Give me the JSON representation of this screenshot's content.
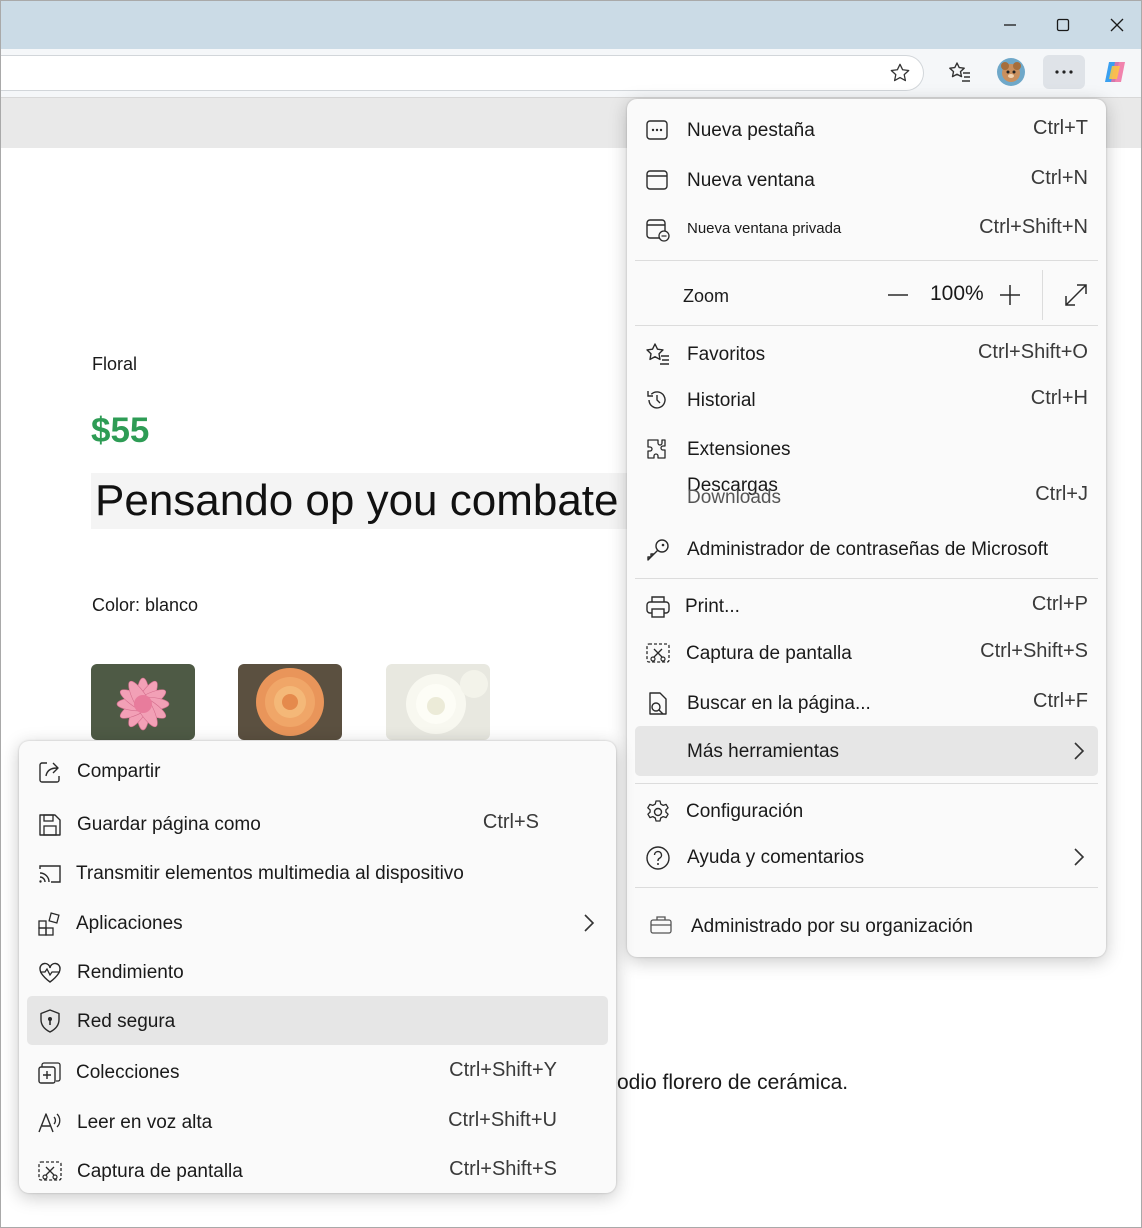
{
  "window": {
    "controls": {
      "minimize": "minimize-icon",
      "maximize": "maximize-icon",
      "close": "close-icon"
    }
  },
  "toolbar": {
    "icons": [
      "star-icon",
      "favorites-icon",
      "profile-avatar",
      "more-icon",
      "copilot-icon"
    ]
  },
  "page": {
    "category": "Floral",
    "price": "$55",
    "headline": "Pensando op you combate u",
    "color_label": "Color: blanco",
    "body_fragment": "odio florero de cerámica.",
    "swatches": [
      "pink-flower",
      "orange-flower",
      "white-flower"
    ]
  },
  "main_menu": {
    "new_tab": {
      "label": "Nueva pestaña",
      "shortcut": "Ctrl+T"
    },
    "new_window": {
      "label": "Nueva ventana",
      "shortcut": "Ctrl+N"
    },
    "private_window": {
      "label": "Nueva ventana privada",
      "shortcut": "Ctrl+Shift+N"
    },
    "zoom": {
      "label": "Zoom",
      "value": "100%"
    },
    "favorites": {
      "label": "Favoritos",
      "shortcut": "Ctrl+Shift+O"
    },
    "history": {
      "label": "Historial",
      "shortcut": "Ctrl+H"
    },
    "extensions": {
      "label": "Extensiones"
    },
    "downloads": {
      "label": "Descargas",
      "label_overlap": "Downloads",
      "shortcut": "Ctrl+J"
    },
    "passwords": {
      "label": "Administrador de contraseñas de Microsoft"
    },
    "print": {
      "label": "Print...",
      "shortcut": "Ctrl+P"
    },
    "screenshot": {
      "label": "Captura de pantalla",
      "shortcut": "Ctrl+Shift+S"
    },
    "find": {
      "label": "Buscar en la página...",
      "shortcut": "Ctrl+F"
    },
    "more_tools": {
      "label": "Más herramientas"
    },
    "settings": {
      "label": "Configuración"
    },
    "help": {
      "label": "Ayuda y comentarios"
    },
    "managed": {
      "label": "Administrado por su organización"
    }
  },
  "sub_menu": {
    "share": {
      "label": "Compartir"
    },
    "save_page": {
      "label": "Guardar página como",
      "shortcut": "Ctrl+S"
    },
    "cast": {
      "label": "Transmitir elementos multimedia al dispositivo"
    },
    "apps": {
      "label": "Aplicaciones"
    },
    "performance": {
      "label": "Rendimiento"
    },
    "secure_network": {
      "label": "Red segura"
    },
    "collections": {
      "label": "Colecciones",
      "shortcut": "Ctrl+Shift+Y"
    },
    "read_aloud": {
      "label": "Leer en voz alta",
      "shortcut": "Ctrl+Shift+U"
    },
    "screenshot": {
      "label": "Captura de pantalla",
      "shortcut": "Ctrl+Shift+S"
    }
  },
  "colors": {
    "titlebar": "#cbdbe6",
    "price_green": "#2e9c55",
    "highlight": "#e6e6e6"
  }
}
